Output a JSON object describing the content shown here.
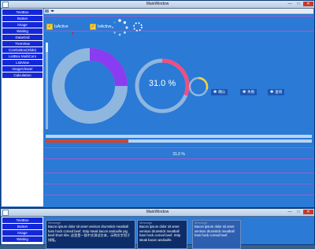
{
  "window_title": "MainWindow",
  "window2_title": "MainWindow",
  "window_controls": {
    "min": "—",
    "max": "□",
    "close": "✕"
  },
  "sidebar": [
    {
      "label": "TextBox"
    },
    {
      "label": "Button"
    },
    {
      "label": "Image"
    },
    {
      "label": "Waiting"
    },
    {
      "label": "DataGrid"
    },
    {
      "label": "TreeView"
    },
    {
      "label": "ComboBox(Slide)"
    },
    {
      "label": "ListBox MultiCom"
    },
    {
      "label": "ListView"
    },
    {
      "label": "ImageViewer"
    },
    {
      "label": "Calculation"
    }
  ],
  "sidebar2": [
    {
      "label": "TextBox"
    },
    {
      "label": "Button"
    },
    {
      "label": "Image"
    },
    {
      "label": "Waiting"
    }
  ],
  "toolbar": {
    "arrow": "◂▸"
  },
  "checkboxes": [
    {
      "label": "IsActive",
      "checked": true
    },
    {
      "label": "IsActive",
      "checked": true
    }
  ],
  "progress_ring_percent": "31.0 %",
  "progress_label": "31.0 %",
  "progress_value": 0.31,
  "donut_fraction": 0.25,
  "ring_fraction": 0.31,
  "small_ring_fraction": 0.3,
  "buttons": [
    {
      "icon": "gear-icon",
      "glyph": "✽",
      "label": "确认"
    },
    {
      "icon": "gear-icon",
      "glyph": "✽",
      "label": "失败"
    },
    {
      "icon": "gear-icon",
      "glyph": "✽",
      "label": "查询"
    }
  ],
  "text_panels": [
    {
      "header": "Message",
      "text": "Bacon ipsum dolor sit amet venison drumstick meatball ham hock corned beef. Strip steak bacon andouille pig beef short ribs. 这里是一段中文测试文本，示例文字用于排版。"
    },
    {
      "header": "Message",
      "text": "Bacon ipsum dolor sit amet venison drumstick meatball ham hock corned beef. Strip steak bacon andouille."
    },
    {
      "header": "Message",
      "text": "Bacon ipsum dolor sit amet venison drumstick meatball ham hock corned beef."
    }
  ],
  "colors": {
    "background": "#2a7ad6",
    "sidebar_item": "#1428d8",
    "donut_purple": "#8a3cf0",
    "donut_track": "#8fb6df",
    "ring_pink": "#ef4f7f",
    "ring_yellow": "#f2d23c",
    "progress_red": "#d0452e"
  }
}
